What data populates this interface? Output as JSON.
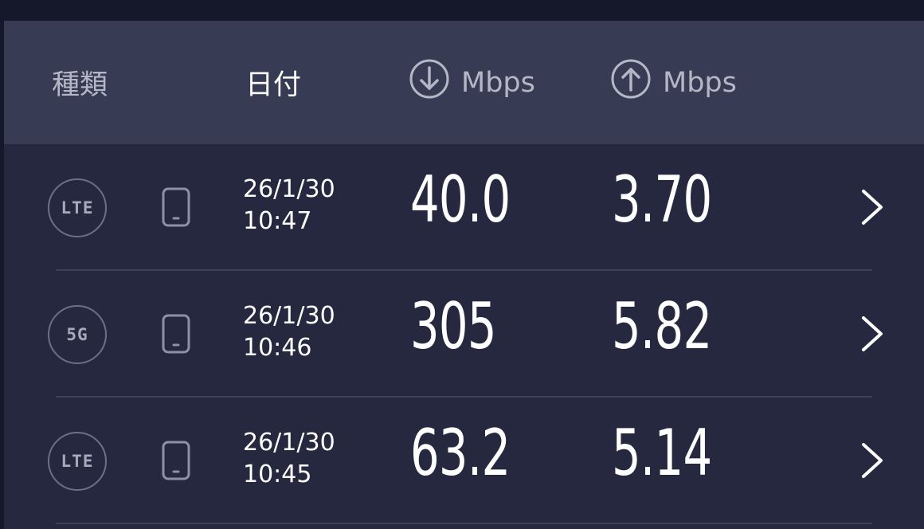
{
  "header": {
    "type_label": "種類",
    "date_label": "日付",
    "download_unit": "Mbps",
    "upload_unit": "Mbps",
    "download_icon": "arrow-down-circle-icon",
    "upload_icon": "arrow-up-circle-icon"
  },
  "rows": [
    {
      "network": "LTE",
      "date": "26/1/30",
      "time": "10:47",
      "download": "40.0",
      "upload": "3.70"
    },
    {
      "network": "5G",
      "date": "26/1/30",
      "time": "10:46",
      "download": "305",
      "upload": "5.82"
    },
    {
      "network": "LTE",
      "date": "26/1/30",
      "time": "10:45",
      "download": "63.2",
      "upload": "5.14"
    }
  ],
  "icons": {
    "device": "smartphone-icon",
    "detail": "chevron-right-icon"
  },
  "colors": {
    "background": "#262840",
    "header_background": "#383b54",
    "top_bar": "#15172a",
    "text_primary": "#ffffff",
    "text_secondary": "#b5b7c6"
  }
}
